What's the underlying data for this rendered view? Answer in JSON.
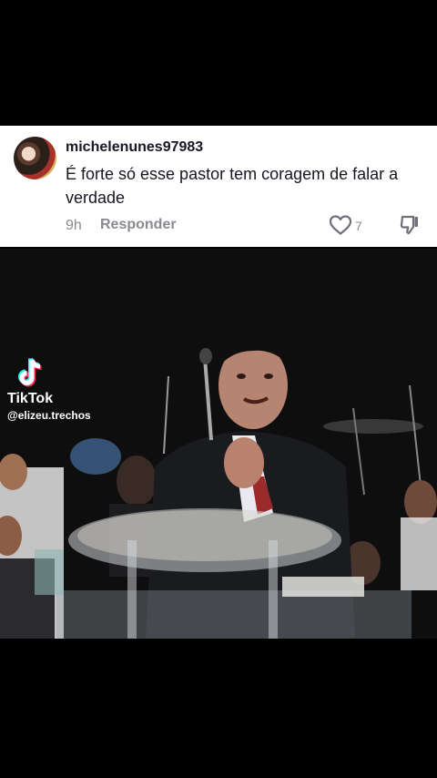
{
  "comment": {
    "username": "michelenunes97983",
    "text": "É forte só esse pastor tem coragem de falar a verdade",
    "time": "9h",
    "reply_label": "Responder",
    "like_count": "7"
  },
  "video": {
    "watermark": {
      "brand": "TikTok",
      "handle": "@elizeu.trechos"
    }
  },
  "colors": {
    "text_primary": "#161823",
    "text_secondary": "#8a8b91",
    "background": "#000000",
    "card": "#ffffff"
  },
  "icons": [
    "tiktok-logo-icon",
    "heart-outline-icon",
    "thumbs-down-icon"
  ]
}
